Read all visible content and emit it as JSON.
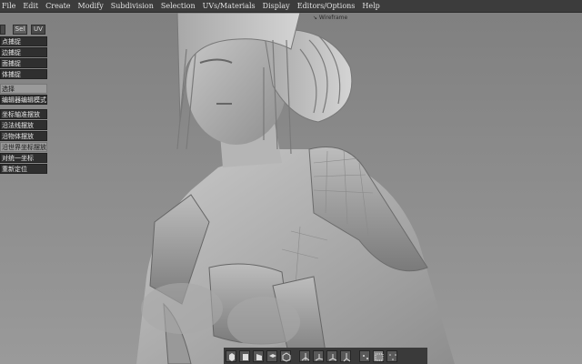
{
  "menu": [
    "File",
    "Edit",
    "Create",
    "Modify",
    "Subdivision",
    "Selection",
    "UVs/Materials",
    "Display",
    "Editors/Options",
    "Help"
  ],
  "tabs": [
    "",
    "Sel",
    "UV"
  ],
  "panel_group1": [
    "点捕捉",
    "边捕捉",
    "面捕捉",
    "体捕捉"
  ],
  "panel_group2": [
    "选择",
    "编辑器编辑模式"
  ],
  "panel_group3": [
    "坐标轴准摆放",
    "沿法线摆放",
    "沿物体摆放",
    "沿世界坐标摆放",
    "对统一坐标",
    "重新定位"
  ],
  "viewport_hint": "↘ Wireframe",
  "toolbar_icons": [
    "cube-icon",
    "front-cube-icon",
    "side-cube-icon",
    "top-cube-icon",
    "perspective-cube-icon",
    "move-axis-icon",
    "rotate-axis-icon",
    "scale-axis-icon",
    "world-axis-icon",
    "vertex-mode-icon",
    "edge-mode-icon",
    "face-mode-icon"
  ]
}
